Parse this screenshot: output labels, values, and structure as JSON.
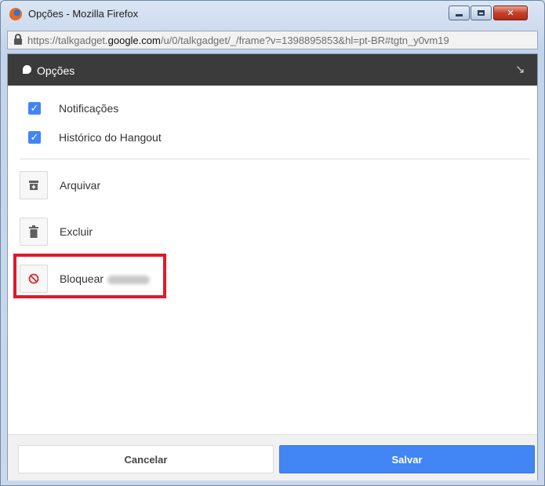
{
  "window": {
    "title": "Opções - Mozilla Firefox",
    "url_prefix": "https://talkgadget.",
    "url_domain": "google.com",
    "url_suffix": "/u/0/talkgadget/_/frame?v=1398895853&hl=pt-BR#tgtn_y0vm19"
  },
  "header": {
    "title": "Opções"
  },
  "options": [
    {
      "label": "Notificações",
      "checked": true
    },
    {
      "label": "Histórico do Hangout",
      "checked": true
    }
  ],
  "actions": [
    {
      "label": "Arquivar",
      "icon": "archive-icon"
    },
    {
      "label": "Excluir",
      "icon": "trash-icon"
    },
    {
      "label": "Bloquear",
      "icon": "block-icon"
    }
  ],
  "footer": {
    "cancel_label": "Cancelar",
    "save_label": "Salvar"
  },
  "colors": {
    "accent": "#4285f4",
    "highlight": "#e01a2a",
    "header": "#3b3b3b"
  }
}
